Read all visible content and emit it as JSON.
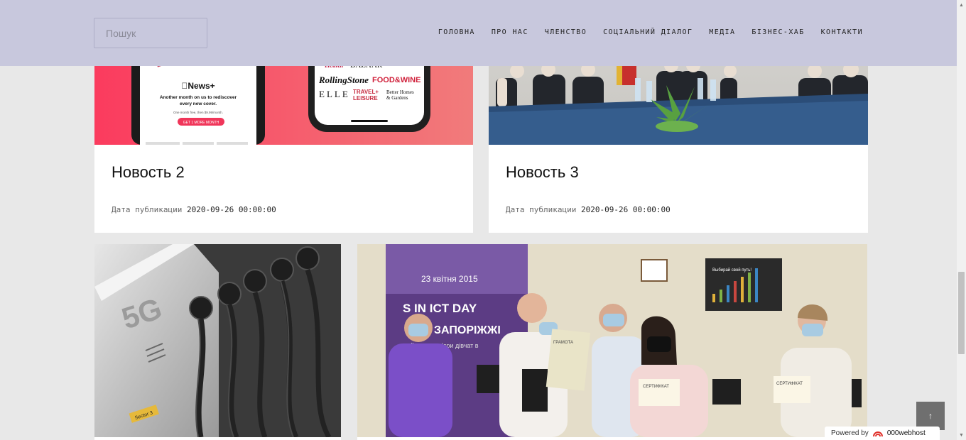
{
  "header": {
    "search_placeholder": "Пошук",
    "nav": [
      "ГОЛОВНА",
      "ПРО НАС",
      "ЧЛЕНСТВО",
      "СОЦІАЛЬНИЙ ДІАЛОГ",
      "МЕДІА",
      "БІЗНЕС-ХАБ",
      "КОНТАКТИ"
    ]
  },
  "news": [
    {
      "title": "Новость 2",
      "date_label": "Дата публикации",
      "date": "2020-09-26 00:00:00",
      "image": {
        "badge": "News+",
        "promo_line1": "Another month on us to rediscover",
        "promo_line2": "every new cover.",
        "promo_small": "One month free, then $9.99/month.",
        "promo_button": "GET 1 MORE MONTH",
        "mag_health": "Health",
        "mag_bazaar": "BAZAAR",
        "mag_rolling": "RollingStone",
        "mag_food": "FOOD&WINE",
        "mag_elle": "ELLE",
        "mag_travel_1": "TRAVEL+",
        "mag_travel_2": "LEISURE",
        "mag_bhg_1": "Better Homes",
        "mag_bhg_2": "& Gardens"
      }
    },
    {
      "title": "Новость 3",
      "date_label": "Дата публикации",
      "date": "2020-09-26 00:00:00"
    },
    {
      "image": {
        "label": "5G",
        "sticker": "Sector 3"
      }
    },
    {
      "image": {
        "banner_date": "23 квітня 2015",
        "banner_line1": "S IN ICT DAY",
        "banner_line2": "В ЗАПОРІЖЖІ",
        "banner_line3": "ий день кар'єри дівчат в",
        "poster_title": "Выбирай свой путь!",
        "cert_1": "ГРАМОТА",
        "cert_2": "СЕРТИФІКАТ",
        "cert_3": "СЕРТИФІКАТ"
      }
    }
  ],
  "scroll_top_icon": "arrow-up",
  "powered_by": {
    "label": "Powered by",
    "brand": "000webhost"
  },
  "colors": {
    "header_bg": "#c8c8dd",
    "page_bg": "#e8e8e8",
    "card_bg": "#ffffff",
    "pink": "#f5586f"
  }
}
